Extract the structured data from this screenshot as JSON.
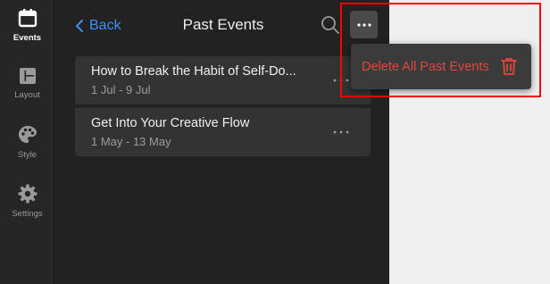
{
  "sidebar": {
    "items": [
      {
        "label": "Events",
        "icon": "calendar-icon"
      },
      {
        "label": "Layout",
        "icon": "layout-icon"
      },
      {
        "label": "Style",
        "icon": "palette-icon"
      },
      {
        "label": "Settings",
        "icon": "gear-icon"
      }
    ]
  },
  "header": {
    "back_label": "Back",
    "title": "Past Events"
  },
  "events": [
    {
      "title": "How to Break the Habit of Self-Do...",
      "dates": "1 Jul - 9 Jul"
    },
    {
      "title": "Get Into Your Creative Flow",
      "dates": "1 May - 13 May"
    }
  ],
  "menu": {
    "delete_label": "Delete All Past Events"
  },
  "colors": {
    "accent": "#3d8ef7",
    "danger": "#e2473c",
    "highlight": "#ff0000"
  }
}
